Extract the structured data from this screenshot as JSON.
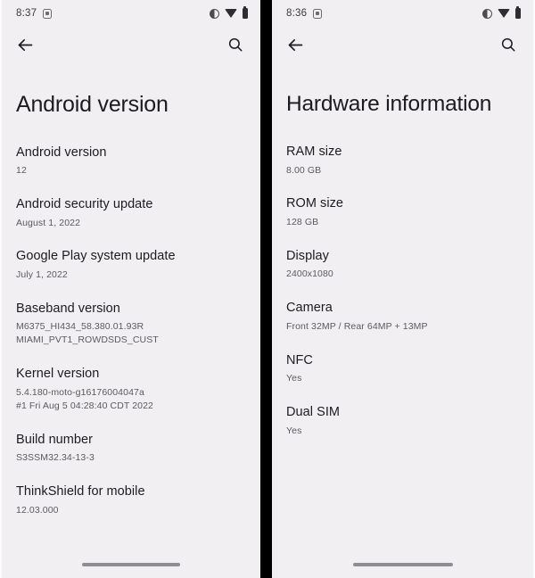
{
  "panels": [
    {
      "status": {
        "time": "8:37",
        "app_icon": "screenshot-icon",
        "icons": [
          "do-not-disturb-icon",
          "wifi-icon",
          "battery-icon"
        ]
      },
      "actions": {
        "back": "back-arrow-icon",
        "search": "search-icon"
      },
      "title": "Android version",
      "rows": [
        {
          "title": "Android version",
          "sub": [
            "12"
          ]
        },
        {
          "title": "Android security update",
          "sub": [
            "August 1, 2022"
          ]
        },
        {
          "title": "Google Play system update",
          "sub": [
            "July 1, 2022"
          ]
        },
        {
          "title": "Baseband version",
          "sub": [
            "M6375_HI434_58.380.01.93R",
            "MIAMI_PVT1_ROWDSDS_CUST"
          ]
        },
        {
          "title": "Kernel version",
          "sub": [
            "5.4.180-moto-g16176004047a",
            "#1 Fri Aug 5 04:28:40 CDT 2022"
          ]
        },
        {
          "title": "Build number",
          "sub": [
            "S3SSM32.34-13-3"
          ]
        },
        {
          "title": "ThinkShield for mobile",
          "sub": [
            "12.03.000"
          ]
        }
      ]
    },
    {
      "status": {
        "time": "8:36",
        "app_icon": "screenshot-icon",
        "icons": [
          "do-not-disturb-icon",
          "wifi-icon",
          "battery-icon"
        ]
      },
      "actions": {
        "back": "back-arrow-icon",
        "search": "search-icon"
      },
      "title": "Hardware information",
      "rows": [
        {
          "title": "RAM size",
          "sub": [
            "8.00 GB"
          ]
        },
        {
          "title": "ROM size",
          "sub": [
            "128 GB"
          ]
        },
        {
          "title": "Display",
          "sub": [
            "2400x1080"
          ]
        },
        {
          "title": "Camera",
          "sub": [
            "Front 32MP / Rear 64MP + 13MP"
          ]
        },
        {
          "title": "NFC",
          "sub": [
            "Yes"
          ]
        },
        {
          "title": "Dual SIM",
          "sub": [
            "Yes"
          ]
        }
      ]
    }
  ],
  "theme": {
    "background": "#f1eff2",
    "text_primary": "#1d1b20",
    "text_secondary": "#5c5a60",
    "divider": "#000000",
    "nav_pill": "#8f8d93"
  }
}
